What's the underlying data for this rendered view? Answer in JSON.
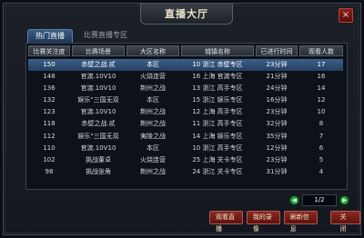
{
  "window": {
    "title": "直播大厅",
    "close_label": "×"
  },
  "tabs": [
    {
      "label": "热门直播"
    },
    {
      "label": "比赛直播专区"
    }
  ],
  "table": {
    "headers": [
      "比赛关注度",
      "比赛场景",
      "大区名称",
      "城镇名称",
      "已进行时间",
      "观看人数"
    ],
    "rows": [
      {
        "fans": "150",
        "site": "赤壁之战.贰",
        "zone": "本区",
        "city": "10 浙江 赤壁专区",
        "time": "23分钟",
        "viewers": "17"
      },
      {
        "fans": "148",
        "site": "官渡.10V10",
        "zone": "火烧连营",
        "city": "16 上海 官渡专区",
        "time": "21分钟",
        "viewers": "16"
      },
      {
        "fans": "136",
        "site": "官渡.10V10",
        "zone": "荆州之战",
        "city": "13 浙江 高手专区",
        "time": "24分钟",
        "viewers": "14"
      },
      {
        "fans": "132",
        "site": "娱乐\"三国无双",
        "zone": "本区",
        "city": "15 浙江 娱乐专区",
        "time": "16分钟",
        "viewers": "12"
      },
      {
        "fans": "123",
        "site": "官渡.10V10",
        "zone": "荆州之战",
        "city": "12 上海 高手专区",
        "time": "23分钟",
        "viewers": "10"
      },
      {
        "fans": "118",
        "site": "赤壁之战.贰",
        "zone": "荆州之战",
        "city": "11 浙江 高手专区",
        "time": "32分钟",
        "viewers": "8"
      },
      {
        "fans": "112",
        "site": "娱乐\"三国无双",
        "zone": "夷陵之战",
        "city": "14 上海 娱乐专区",
        "time": "35分钟",
        "viewers": "7"
      },
      {
        "fans": "110",
        "site": "官渡.10V10",
        "zone": "本区",
        "city": "10 浙江 高手专区",
        "time": "12分钟",
        "viewers": "6"
      },
      {
        "fans": "102",
        "site": "挑战董卓",
        "zone": "火烧连营",
        "city": "25 上海 关卡专区",
        "time": "23分钟",
        "viewers": "5"
      },
      {
        "fans": "98",
        "site": "挑战张角",
        "zone": "荆州之战",
        "city": "24 浙江 关卡专区",
        "time": "31分钟",
        "viewers": "4"
      }
    ]
  },
  "pager": {
    "prev": "◀",
    "next": "▶",
    "page": "1/2"
  },
  "buttons": {
    "watch": "观看直播",
    "my_recordings": "我的录像",
    "refresh": "刷新信息",
    "close": "关闭"
  }
}
